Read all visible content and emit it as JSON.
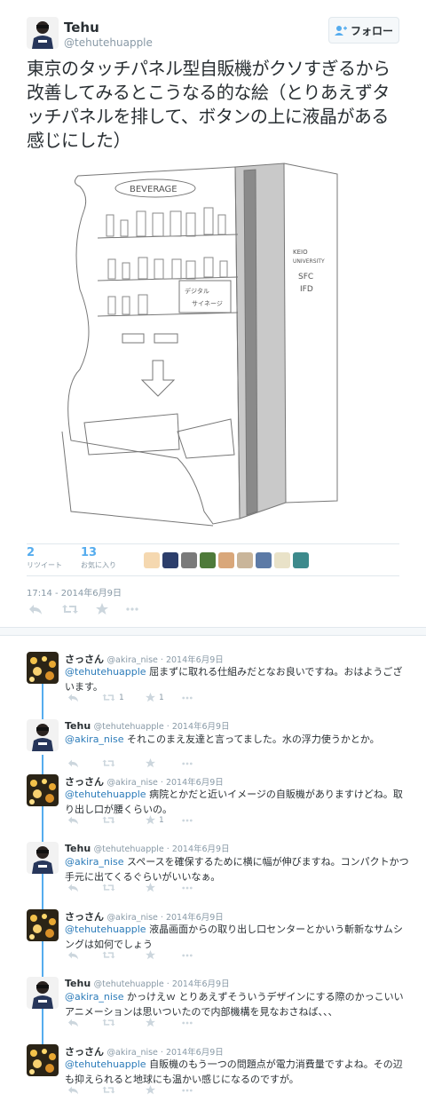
{
  "tweet": {
    "author_name": "Tehu",
    "author_handle": "@tehutehuapple",
    "follow_label": "フォロー",
    "text": "東京のタッチパネル型自販機がクソすぎるから改善してみるとこうなる的な絵（とりあえずタッチパネルを排して、ボタンの上に液晶がある感じにした）",
    "drawing": {
      "sign": "BEVERAGE",
      "screen_line1": "デジタル",
      "screen_line2": "サイネージ",
      "side_text1": "KEIO",
      "side_text2": "UNIVERSITY",
      "side_text3": "SFC",
      "side_text4": "IFD"
    },
    "retweets_count": "2",
    "retweets_label": "リツイート",
    "favorites_count": "13",
    "favorites_label": "お気に入り",
    "timestamp": "17:14 - 2014年6月9日"
  },
  "replies": [
    {
      "name": "さっさん",
      "handle": "@akira_nise",
      "date": "2014年6月9日",
      "mention": "@tehutehuapple",
      "text": " 屈まずに取れる仕組みだとなお良いですね。おはようございます。",
      "rt": "1",
      "fav": "1"
    },
    {
      "name": "Tehu",
      "handle": "@tehutehuapple",
      "date": "2014年6月9日",
      "mention": "@akira_nise",
      "text": " それこのまえ友達と言ってました。水の浮力使うかとか。",
      "rt": "",
      "fav": ""
    },
    {
      "name": "さっさん",
      "handle": "@akira_nise",
      "date": "2014年6月9日",
      "mention": "@tehutehuapple",
      "text": " 病院とかだと近いイメージの自販機がありますけどね。取り出し口が腰くらいの。",
      "rt": "",
      "fav": "1"
    },
    {
      "name": "Tehu",
      "handle": "@tehutehuapple",
      "date": "2014年6月9日",
      "mention": "@akira_nise",
      "text": " スペースを確保するために横に幅が伸びますね。コンパクトかつ手元に出てくるぐらいがいいなぁ。",
      "rt": "",
      "fav": ""
    },
    {
      "name": "さっさん",
      "handle": "@akira_nise",
      "date": "2014年6月9日",
      "mention": "@tehutehuapple",
      "text": " 液晶画面からの取り出し口センターとかいう斬新なサムシングは如何でしょう",
      "rt": "",
      "fav": ""
    },
    {
      "name": "Tehu",
      "handle": "@tehutehuapple",
      "date": "2014年6月9日",
      "mention": "@akira_nise",
      "text": " かっけえｗ とりあえずそういうデザインにする際のかっこいいアニメーションは思いついたので内部機構を見なおさねば、、、",
      "rt": "",
      "fav": ""
    },
    {
      "name": "さっさん",
      "handle": "@akira_nise",
      "date": "2014年6月9日",
      "mention": "@tehutehuapple",
      "text": " 自販機のもう一つの問題点が電力消費量ですよね。その辺も抑えられると地球にも温かい感じになるのですが。",
      "rt": "",
      "fav": ""
    }
  ],
  "colors": {
    "accent": "#55acee",
    "link": "#2b7bb9",
    "muted": "#8899a6"
  }
}
